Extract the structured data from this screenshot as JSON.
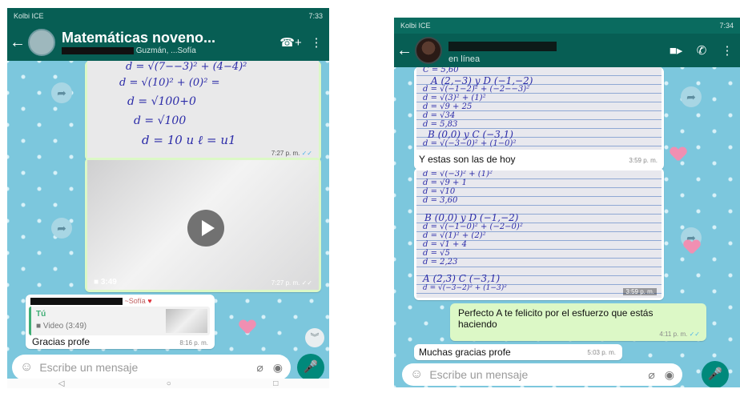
{
  "colors": {
    "header": "#075e54",
    "outgoing": "#dcf8c6",
    "accent": "#00897b",
    "read_ticks": "#4fb3e9"
  },
  "left": {
    "status": {
      "carrier": "Kolbi ICE",
      "time": "7:33"
    },
    "chat_title": "Matemáticas noveno...",
    "chat_subtitle": "Guzmán, ...Sofía",
    "work": {
      "line1": "d = √(7−−3)² + (4−4)²",
      "line2": "d = √(10)² + (0)² =",
      "line3": "d = √100+0",
      "line4": "d = √100",
      "line5": "d = 10 u ℓ = u1"
    },
    "photo_time": "7:27 p. m.",
    "video_duration": "3:49",
    "video_time": "7:27 p. m.",
    "reply": {
      "sender_suffix": "~Sofía",
      "quoted_name": "Tú",
      "quoted_text": "Video (3:49)",
      "text": "Gracias profe",
      "time": "8:16 p. m."
    },
    "input_placeholder": "Escribe un mensaje",
    "icons": {
      "back": "back-arrow-icon",
      "call": "add-call-icon",
      "menu": "more-icon",
      "emoji": "emoji-icon",
      "attach": "attach-icon",
      "camera": "camera-icon",
      "mic": "mic-icon"
    }
  },
  "right": {
    "status": {
      "carrier": "Kolbi ICE",
      "time": "7:34"
    },
    "chat_status": "en línea",
    "notes1": {
      "l1": "C = 5,60",
      "l2": "A (2,−3) y D (−1,−2)",
      "l3": "d = √(−1−2)² + (−2−−3)²",
      "l4": "d = √(3)² + (1)²",
      "l5": "d = √9 + 25",
      "l6": "d = √34",
      "l7": "d = 5,83",
      "l8": "B (0,0) y C (−3,1)",
      "l9": "d = √(−3−0)² + (1−0)²"
    },
    "caption": "Y estas son las de hoy",
    "caption_time": "3:59 p. m.",
    "notes2": {
      "l1": "d = √(−3)² + (1)²",
      "l2": "d = √9 + 1",
      "l3": "d = √10",
      "l4": "d = 3,60",
      "l5": "B (0,0) y D (−1,−2)",
      "l6": "d = √(−1−0)² + (−2−0)²",
      "l7": "d = √(1)² + (2)²",
      "l8": "d = √1 + 4",
      "l9": "d = √5",
      "l10": "d = 2,23",
      "l11": "A (2,3) C (−3,1)",
      "l12": "d = √(−3−2)² + (1−3)²"
    },
    "photo2_time": "3:59 p. m.",
    "teacher_msg": "Perfecto A      te felicito por el esfuerzo que estás haciendo",
    "teacher_time": "4:11 p. m.",
    "student_msg": "Muchas gracias profe",
    "student_time": "5:03 p. m.",
    "input_placeholder": "Escribe un mensaje",
    "icons": {
      "back": "back-arrow-icon",
      "video": "video-call-icon",
      "call": "phone-icon",
      "menu": "more-icon"
    }
  }
}
